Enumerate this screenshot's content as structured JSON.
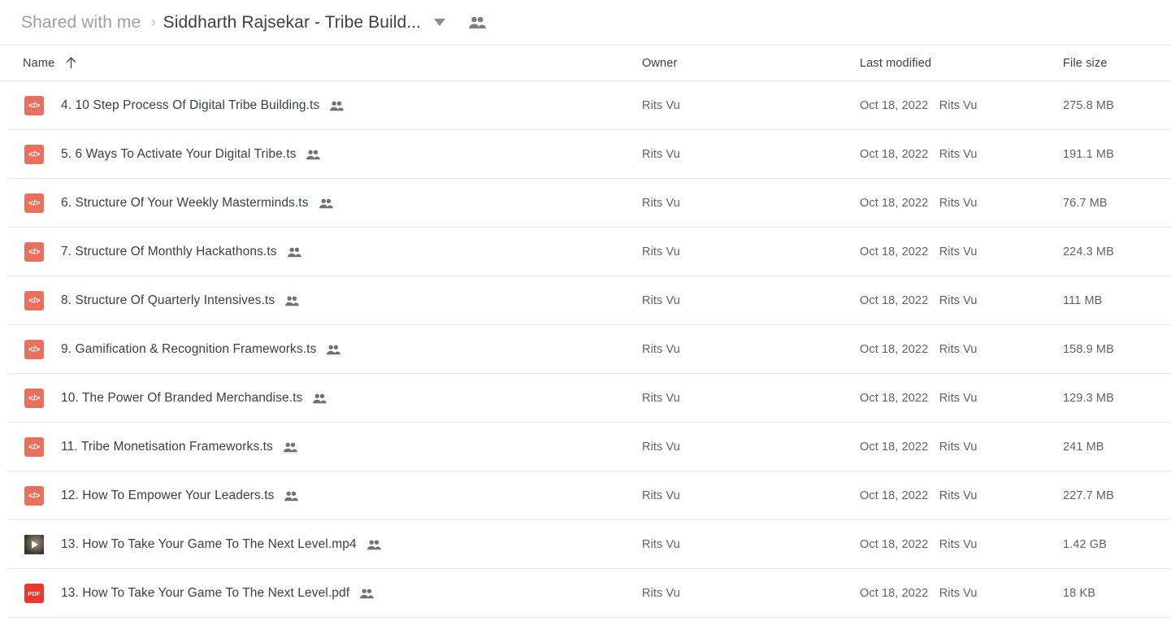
{
  "breadcrumb": {
    "parent": "Shared with me",
    "separator": "›",
    "current": "Siddharth Rajsekar - Tribe Build...",
    "chevron_icon": "chevron-down-icon",
    "people_icon": "people-shared-icon"
  },
  "columns": {
    "name": "Name",
    "owner": "Owner",
    "last_modified": "Last modified",
    "file_size": "File size",
    "sort_direction_icon": "arrow-up-icon"
  },
  "colors": {
    "code_icon_bg": "#e8705f",
    "pdf_icon_bg": "#e8392b",
    "text_primary": "#3c4043",
    "text_secondary": "#5f6368",
    "breadcrumb_inactive": "#9aa0a6",
    "row_divider": "#e8e8e8"
  },
  "files": [
    {
      "name": "4. 10 Step Process Of Digital Tribe Building.ts",
      "icon": "code-file-icon",
      "icon_label": "</>",
      "shared_icon": "people-shared-icon",
      "owner": "Rits Vu",
      "modified_date": "Oct 18, 2022",
      "modified_by": "Rits Vu",
      "size": "275.8 MB"
    },
    {
      "name": "5. 6 Ways To Activate Your Digital Tribe.ts",
      "icon": "code-file-icon",
      "icon_label": "</>",
      "shared_icon": "people-shared-icon",
      "owner": "Rits Vu",
      "modified_date": "Oct 18, 2022",
      "modified_by": "Rits Vu",
      "size": "191.1 MB"
    },
    {
      "name": "6. Structure Of Your Weekly Masterminds.ts",
      "icon": "code-file-icon",
      "icon_label": "</>",
      "shared_icon": "people-shared-icon",
      "owner": "Rits Vu",
      "modified_date": "Oct 18, 2022",
      "modified_by": "Rits Vu",
      "size": "76.7 MB"
    },
    {
      "name": "7. Structure Of Monthly Hackathons.ts",
      "icon": "code-file-icon",
      "icon_label": "</>",
      "shared_icon": "people-shared-icon",
      "owner": "Rits Vu",
      "modified_date": "Oct 18, 2022",
      "modified_by": "Rits Vu",
      "size": "224.3 MB"
    },
    {
      "name": "8. Structure Of Quarterly Intensives.ts",
      "icon": "code-file-icon",
      "icon_label": "</>",
      "shared_icon": "people-shared-icon",
      "owner": "Rits Vu",
      "modified_date": "Oct 18, 2022",
      "modified_by": "Rits Vu",
      "size": "111 MB"
    },
    {
      "name": "9. Gamification & Recognition Frameworks.ts",
      "icon": "code-file-icon",
      "icon_label": "</>",
      "shared_icon": "people-shared-icon",
      "owner": "Rits Vu",
      "modified_date": "Oct 18, 2022",
      "modified_by": "Rits Vu",
      "size": "158.9 MB"
    },
    {
      "name": "10. The Power Of Branded Merchandise.ts",
      "icon": "code-file-icon",
      "icon_label": "</>",
      "shared_icon": "people-shared-icon",
      "owner": "Rits Vu",
      "modified_date": "Oct 18, 2022",
      "modified_by": "Rits Vu",
      "size": "129.3 MB"
    },
    {
      "name": "11. Tribe Monetisation Frameworks.ts",
      "icon": "code-file-icon",
      "icon_label": "</>",
      "shared_icon": "people-shared-icon",
      "owner": "Rits Vu",
      "modified_date": "Oct 18, 2022",
      "modified_by": "Rits Vu",
      "size": "241 MB"
    },
    {
      "name": "12. How To Empower Your Leaders.ts",
      "icon": "code-file-icon",
      "icon_label": "</>",
      "shared_icon": "people-shared-icon",
      "owner": "Rits Vu",
      "modified_date": "Oct 18, 2022",
      "modified_by": "Rits Vu",
      "size": "227.7 MB"
    },
    {
      "name": "13. How To Take Your Game To The Next Level.mp4",
      "icon": "video-thumbnail-icon",
      "icon_label": "",
      "shared_icon": "people-shared-icon",
      "owner": "Rits Vu",
      "modified_date": "Oct 18, 2022",
      "modified_by": "Rits Vu",
      "size": "1.42 GB"
    },
    {
      "name": "13. How To Take Your Game To The Next Level.pdf",
      "icon": "pdf-file-icon",
      "icon_label": "PDF",
      "shared_icon": "people-shared-icon",
      "owner": "Rits Vu",
      "modified_date": "Oct 18, 2022",
      "modified_by": "Rits Vu",
      "size": "18 KB"
    }
  ]
}
